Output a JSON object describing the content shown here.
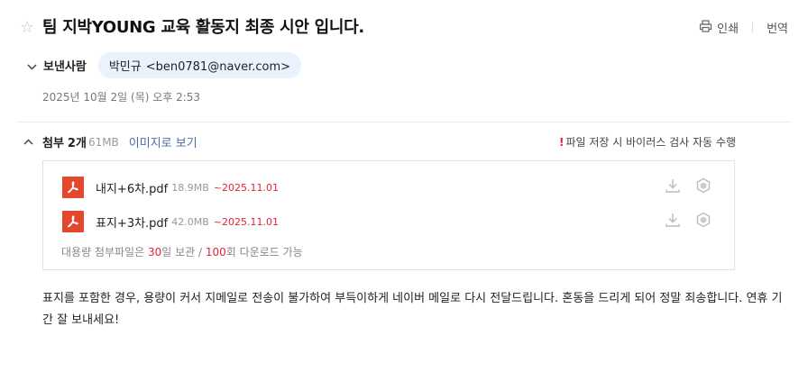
{
  "mail": {
    "star_glyph": "☆",
    "subject": "팀 지박YOUNG 교육 활동지 최종 시안 입니다.",
    "actions": {
      "print_label": "인쇄",
      "translate_label": "번역"
    },
    "sender": {
      "label": "보낸사람",
      "name": "박민규",
      "email": "<ben0781@naver.com>"
    },
    "date": "2025년 10월 2일 (목) 오후 2:53"
  },
  "attachments": {
    "title": "첨부",
    "count": "2개",
    "total_size": "61MB",
    "view_as_image": "이미지로 보기",
    "virus_bang": "!",
    "virus_notice": "파일 저장 시 바이러스 검사 자동 수행",
    "files": [
      {
        "name": "내지+6차.pdf",
        "size": "18.9MB",
        "expires": "~2025.11.01",
        "icon": "pdf-icon"
      },
      {
        "name": "표지+3차.pdf",
        "size": "42.0MB",
        "expires": "~2025.11.01",
        "icon": "pdf-icon"
      }
    ],
    "note": {
      "prefix": "대용량 첨부파일은 ",
      "days": "30",
      "mid1": "일 보관 / ",
      "downloads": "100",
      "suffix": "회 다운로드 가능"
    }
  },
  "body": {
    "text": "표지를 포함한 경우, 용량이 커서 지메일로 전송이 불가하여 부득이하게 네이버 메일로 다시 전달드립니다. 혼동을 드리게 되어 정말 죄송합니다. 연휴 기간 잘 보내세요!"
  },
  "colors": {
    "accent_red": "#e0243a",
    "chip_bg": "#eaf3fd",
    "pdf_red": "#e5472c",
    "link_blue": "#4a6fa5"
  }
}
